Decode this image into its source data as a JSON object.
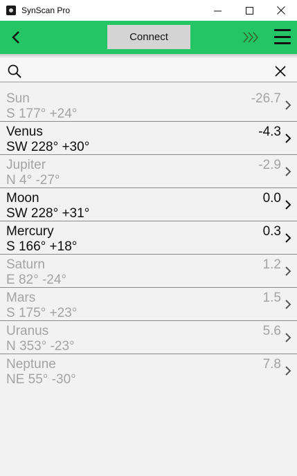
{
  "window": {
    "title": "SynScan Pro",
    "minimize_glyph": "—",
    "maximize_glyph": "☐",
    "close_glyph": "✕"
  },
  "toolbar": {
    "connect_label": "Connect",
    "accent_color": "#23c564"
  },
  "search": {
    "value": "",
    "placeholder": ""
  },
  "objects": [
    {
      "name": "Sun",
      "coords": "S 177° +24°",
      "magnitude": "-26.7",
      "dimmed": true
    },
    {
      "name": "Venus",
      "coords": "SW 228° +30°",
      "magnitude": "-4.3",
      "dimmed": false
    },
    {
      "name": "Jupiter",
      "coords": "N 4° -27°",
      "magnitude": "-2.9",
      "dimmed": true
    },
    {
      "name": "Moon",
      "coords": "SW 228° +31°",
      "magnitude": "0.0",
      "dimmed": false
    },
    {
      "name": "Mercury",
      "coords": "S 166° +18°",
      "magnitude": "0.3",
      "dimmed": false
    },
    {
      "name": "Saturn",
      "coords": "E 82° -24°",
      "magnitude": "1.2",
      "dimmed": true
    },
    {
      "name": "Mars",
      "coords": "S 175° +23°",
      "magnitude": "1.5",
      "dimmed": true
    },
    {
      "name": "Uranus",
      "coords": "N 353° -23°",
      "magnitude": "5.6",
      "dimmed": true
    },
    {
      "name": "Neptune",
      "coords": "NE 55° -30°",
      "magnitude": "7.8",
      "dimmed": true
    }
  ]
}
